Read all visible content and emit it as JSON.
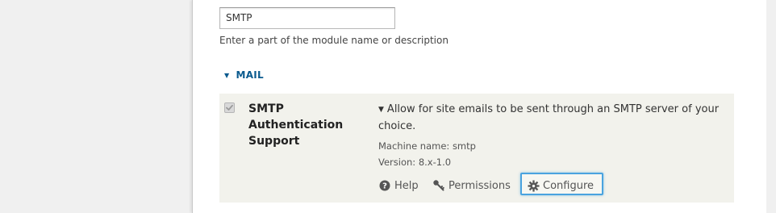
{
  "filter": {
    "value": "SMTP",
    "description": "Enter a part of the module name or description"
  },
  "group": {
    "label": "MAIL"
  },
  "module": {
    "name": "SMTP Authentication Support",
    "checked": true,
    "description": "Allow for site emails to be sent through an SMTP server of your choice.",
    "machine_name": "Machine name: smtp",
    "version": "Version: 8.x-1.0"
  },
  "links": {
    "help": "Help",
    "permissions": "Permissions",
    "configure": "Configure"
  },
  "icons": {
    "help": "help-icon",
    "permissions": "key-icon",
    "configure": "gear-icon",
    "expand": "triangle-down-icon"
  },
  "colors": {
    "group_link": "#0a5a8e",
    "focus_ring": "#4aa3df",
    "row_background": "#f2f2ec"
  }
}
